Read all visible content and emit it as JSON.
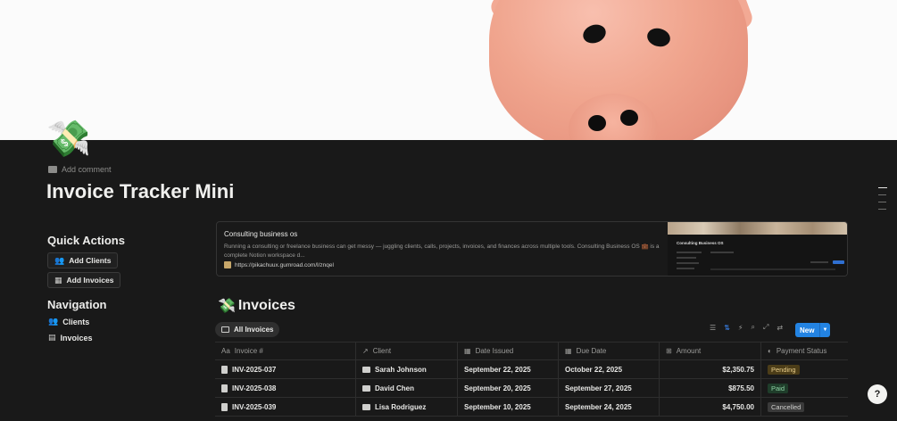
{
  "page": {
    "icon": "💸",
    "add_comment": "Add comment",
    "title": "Invoice Tracker Mini"
  },
  "quick_actions": {
    "heading": "Quick Actions",
    "buttons": [
      {
        "label": "Add Clients",
        "icon": "people-icon"
      },
      {
        "label": "Add Invoices",
        "icon": "calendar-icon"
      }
    ]
  },
  "navigation": {
    "heading": "Navigation",
    "items": [
      {
        "label": "Clients",
        "icon": "people-icon"
      },
      {
        "label": "Invoices",
        "icon": "document-icon"
      }
    ]
  },
  "bookmark": {
    "title": "Consulting business os",
    "description": "Running a consulting or freelance business can get messy — juggling clients, calls, projects, invoices, and finances across multiple tools. Consulting Business OS 💼 is a complete Notion workspace d...",
    "url": "https://pikachuux.gumroad.com/l/znqel",
    "preview_title": "Consulting Business OS"
  },
  "database": {
    "icon": "💸",
    "title": "Invoices",
    "view_tab": "All Invoices",
    "new_button": "New",
    "columns": [
      {
        "label": "Invoice #",
        "icon": "Aa"
      },
      {
        "label": "Client",
        "icon": "↗"
      },
      {
        "label": "Date Issued",
        "icon": "▦"
      },
      {
        "label": "Due Date",
        "icon": "▦"
      },
      {
        "label": "Amount",
        "icon": "⊞"
      },
      {
        "label": "Payment Status",
        "icon": "◐"
      }
    ],
    "rows": [
      {
        "invoice": "INV-2025-037",
        "client": "Sarah Johnson",
        "date_issued": "September 22, 2025",
        "due_date": "October 22, 2025",
        "amount": "$2,350.75",
        "status": "Pending"
      },
      {
        "invoice": "INV-2025-038",
        "client": "David Chen",
        "date_issued": "September 20, 2025",
        "due_date": "September 27, 2025",
        "amount": "$875.50",
        "status": "Paid"
      },
      {
        "invoice": "INV-2025-039",
        "client": "Lisa Rodriguez",
        "date_issued": "September 10, 2025",
        "due_date": "September 24, 2025",
        "amount": "$4,750.00",
        "status": "Cancelled"
      }
    ],
    "status_colors": {
      "Pending": {
        "bg": "#4c3d18",
        "fg": "#e9cf8c"
      },
      "Paid": {
        "bg": "#1f3d2a",
        "fg": "#8fd4a6"
      },
      "Cancelled": {
        "bg": "#3a3a3a",
        "fg": "#cfcfcd"
      }
    }
  },
  "help_label": "?"
}
